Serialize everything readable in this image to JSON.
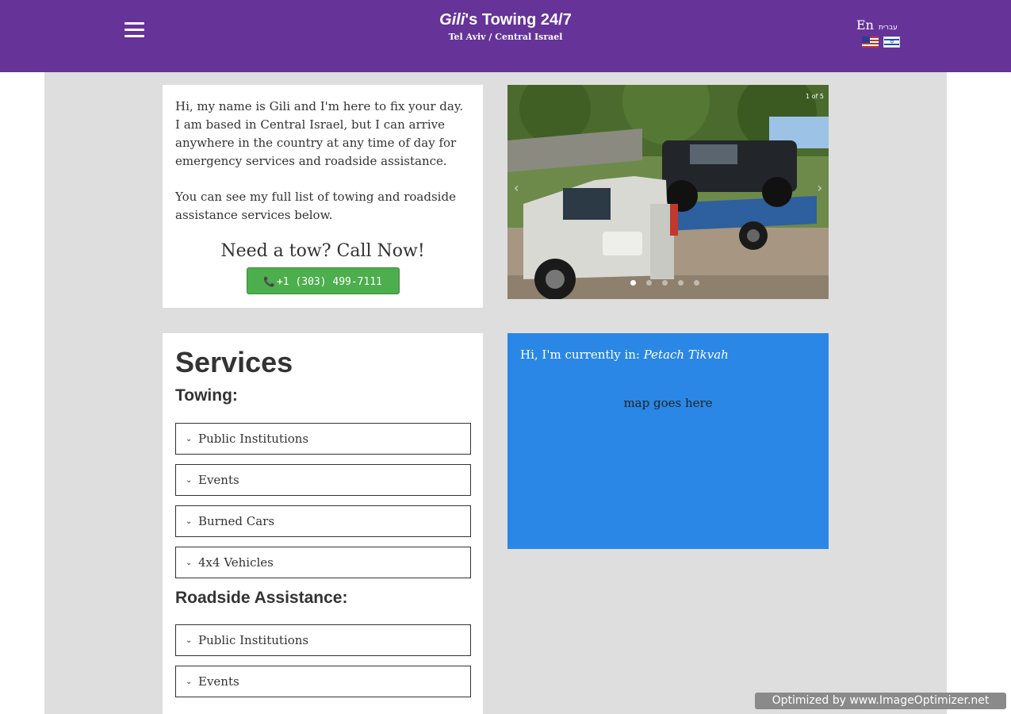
{
  "header": {
    "title_name": "Gili",
    "title_rest": "'s Towing 24/7",
    "subtitle": "Tel Aviv / Central Israel",
    "background_color": "#663399",
    "menu_icon": "hamburger-menu-icon"
  },
  "language": {
    "english_label": "En",
    "hebrew_label": "עברית",
    "flags": [
      "us-flag-icon",
      "israel-flag-icon"
    ]
  },
  "intro": {
    "paragraph_1": "Hi, my name is Gili and I'm here to fix your day. I am based in Central Israel, but I can arrive anywhere in the country at any time of day for emergency services and roadside assistance.",
    "paragraph_2": "You can see my full list of towing and roadside assistance services below.",
    "cta_title": "Need a tow? Call Now!",
    "phone": "+1 (303) 499-7111",
    "button_color": "#4cae4c"
  },
  "carousel": {
    "slide_counter": "1 of 5",
    "current_slide": 1,
    "total_slides": 5,
    "image_description_icon": "tow-truck-carrying-jeep-photo"
  },
  "services": {
    "title": "Services",
    "towing_heading": "Towing:",
    "towing_items": [
      "Public Institutions",
      "Events",
      "Burned Cars",
      "4x4 Vehicles"
    ],
    "roadside_heading": "Roadside Assistance:",
    "roadside_items": [
      "Public Institutions",
      "Events"
    ]
  },
  "location": {
    "prefix": "Hi, I'm currently in: ",
    "city": "Petach Tikvah",
    "map_placeholder": "map goes here",
    "background_color": "#2a87e6"
  },
  "watermark": {
    "text": "Optimized by www.ImageOptimizer.net"
  }
}
